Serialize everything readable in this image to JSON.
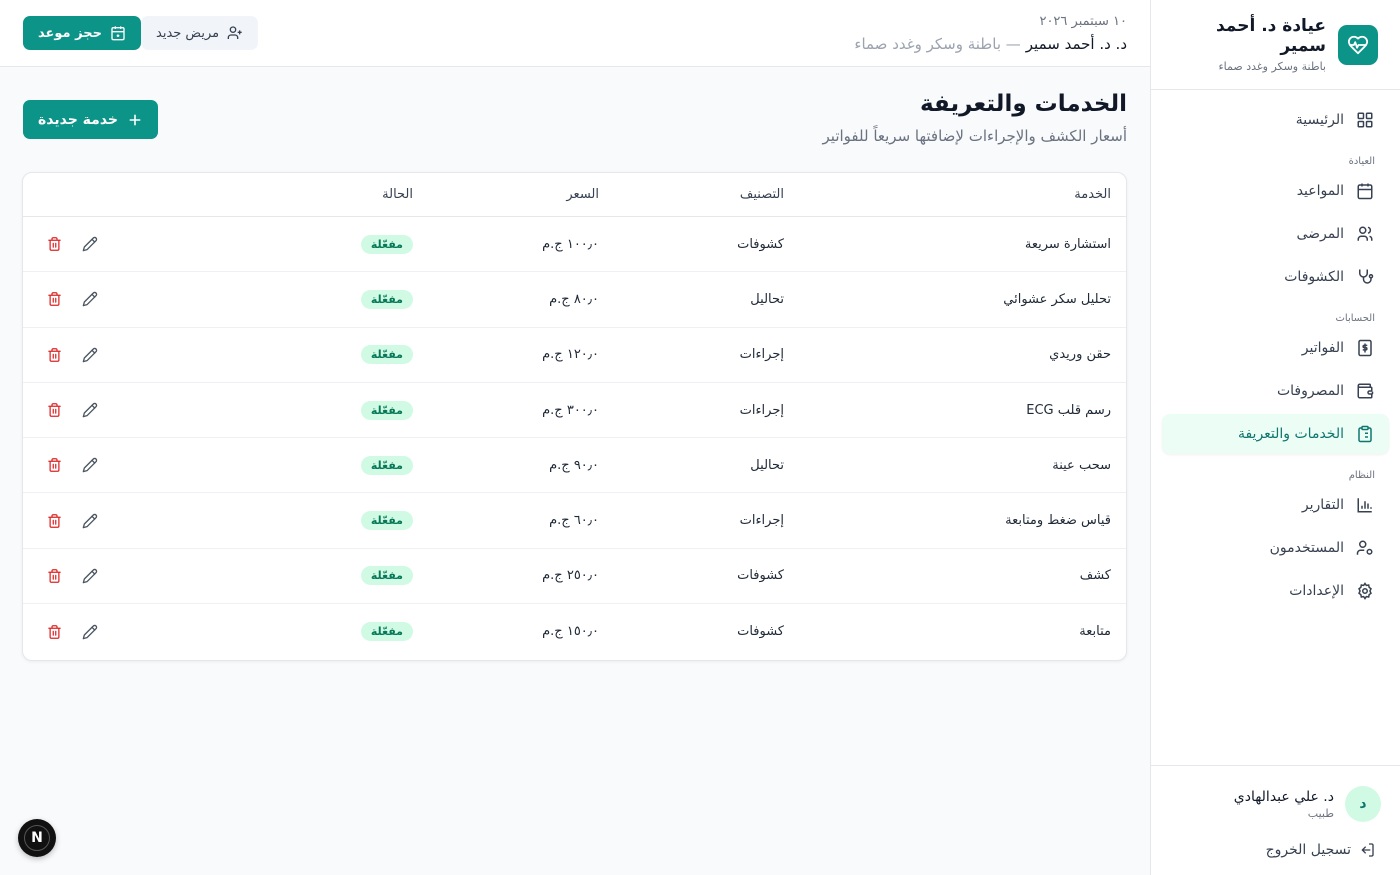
{
  "brand": {
    "title": "عيادة د. أحمد سمير",
    "subtitle": "باطنة وسكر وغدد صماء"
  },
  "sidebar": {
    "items": [
      {
        "label": "الرئيسية",
        "icon": "grid-icon"
      },
      {
        "section": "العيادة"
      },
      {
        "label": "المواعيد",
        "icon": "calendar-icon"
      },
      {
        "label": "المرضى",
        "icon": "users-icon"
      },
      {
        "label": "الكشوفات",
        "icon": "stethoscope-icon"
      },
      {
        "section": "الحسابات"
      },
      {
        "label": "الفواتير",
        "icon": "receipt-icon"
      },
      {
        "label": "المصروفات",
        "icon": "wallet-icon"
      },
      {
        "label": "الخدمات والتعريفة",
        "icon": "clipboard-icon",
        "active": true
      },
      {
        "section": "النظام"
      },
      {
        "label": "التقارير",
        "icon": "bar-chart-icon"
      },
      {
        "label": "المستخدمون",
        "icon": "user-cog-icon"
      },
      {
        "label": "الإعدادات",
        "icon": "settings-icon"
      }
    ],
    "user": {
      "initial": "د",
      "name": "د. علي عبدالهادي",
      "role": "طبيب"
    },
    "logout_label": "تسجيل الخروج"
  },
  "header": {
    "date": "١٠ سبتمبر ٢٠٢٦",
    "doctor_name": "د. د. أحمد سمير",
    "doctor_specialty": "— باطنة وسكر وغدد صماء",
    "book_label": "حجز موعد",
    "new_patient_label": "مريض جديد"
  },
  "page": {
    "title": "الخدمات والتعريفة",
    "subtitle": "أسعار الكشف والإجراءات لإضافتها سريعاً للفواتير",
    "new_service_label": "خدمة جديدة"
  },
  "table": {
    "headers": {
      "service": "الخدمة",
      "category": "التصنيف",
      "price": "السعر",
      "status": "الحالة"
    },
    "rows": [
      {
        "service": "استشارة سريعة",
        "category": "كشوفات",
        "price": "١٠٠٫٠ ج.م",
        "status": "مفعّلة"
      },
      {
        "service": "تحليل سكر عشوائي",
        "category": "تحاليل",
        "price": "٨٠٫٠ ج.م",
        "status": "مفعّلة"
      },
      {
        "service": "حقن وريدي",
        "category": "إجراءات",
        "price": "١٢٠٫٠ ج.م",
        "status": "مفعّلة"
      },
      {
        "service": "رسم قلب ECG",
        "category": "إجراءات",
        "price": "٣٠٠٫٠ ج.م",
        "status": "مفعّلة"
      },
      {
        "service": "سحب عينة",
        "category": "تحاليل",
        "price": "٩٠٫٠ ج.م",
        "status": "مفعّلة"
      },
      {
        "service": "قياس ضغط ومتابعة",
        "category": "إجراءات",
        "price": "٦٠٫٠ ج.م",
        "status": "مفعّلة"
      },
      {
        "service": "كشف",
        "category": "كشوفات",
        "price": "٢٥٠٫٠ ج.م",
        "status": "مفعّلة"
      },
      {
        "service": "متابعة",
        "category": "كشوفات",
        "price": "١٥٠٫٠ ج.م",
        "status": "مفعّلة"
      }
    ]
  },
  "dev_badge": "N",
  "colors": {
    "accent": "#0d9488",
    "accent_light": "#ecfdf5",
    "badge_bg": "#d1fae5",
    "badge_text": "#047857",
    "danger": "#dc2626"
  }
}
